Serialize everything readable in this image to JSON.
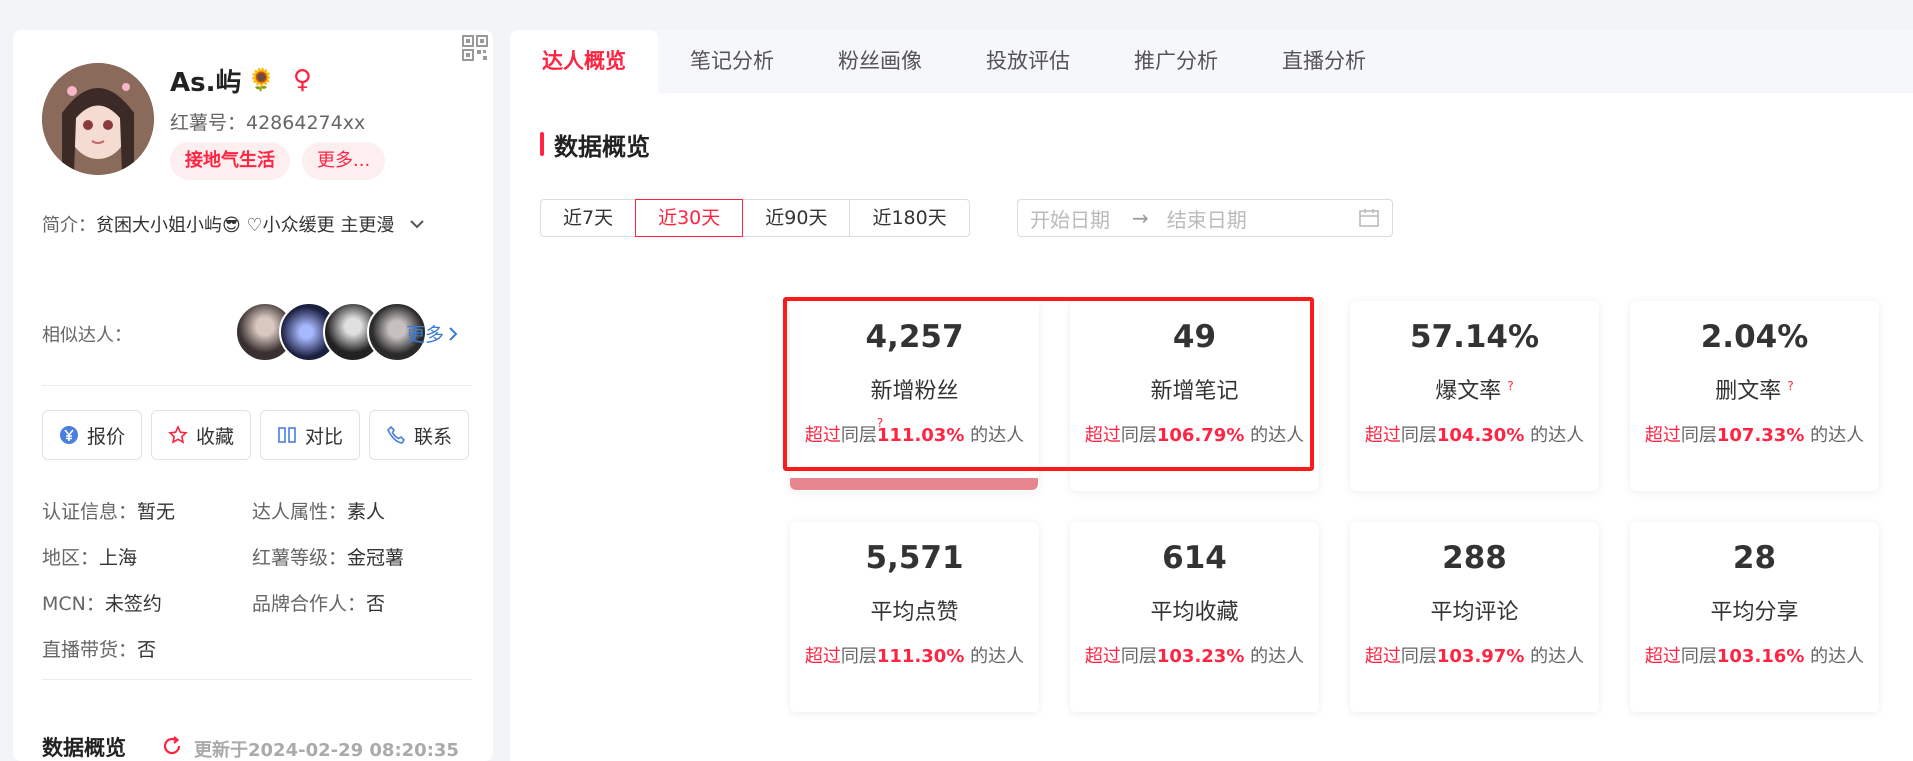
{
  "profile": {
    "name": "As.屿",
    "name_emoji": "🌻",
    "gender_symbol": "♀",
    "redid": "红薯号：42864274xx",
    "tags": [
      "接地气生活",
      "更多..."
    ],
    "intro_label": "简介：",
    "intro_text": "贫困大小姐小屿😎 ♡小众缓更 主更漫",
    "similar_label": "相似达人：",
    "more_label": "更多",
    "actions": [
      "报价",
      "收藏",
      "对比",
      "联系"
    ],
    "info": {
      "cert_label": "认证信息：",
      "cert_value": "暂无",
      "attr_label": "达人属性：",
      "attr_value": "素人",
      "region_label": "地区：",
      "region_value": "上海",
      "level_label": "红薯等级：",
      "level_value": "金冠薯",
      "mcn_label": "MCN：",
      "mcn_value": "未签约",
      "brand_label": "品牌合作人：",
      "brand_value": "否",
      "live_label": "直播带货：",
      "live_value": "否"
    },
    "overview_title": "数据概览",
    "updated": "更新于2024-02-29 08:20:35"
  },
  "tabs": [
    "达人概览",
    "笔记分析",
    "粉丝画像",
    "投放评估",
    "推广分析",
    "直播分析"
  ],
  "section_title": "数据概览",
  "periods": [
    "近7天",
    "近30天",
    "近90天",
    "近180天"
  ],
  "date_start_placeholder": "开始日期",
  "date_arrow": "→",
  "date_end_placeholder": "结束日期",
  "compare": {
    "exceed": "超过",
    "peer": "同层",
    "suffix": " 的达人",
    "q": "?"
  },
  "cards": [
    {
      "value": "4,257",
      "label": "新增粉丝",
      "pct": "111.03%"
    },
    {
      "value": "49",
      "label": "新增笔记",
      "pct": "106.79%"
    },
    {
      "value": "57.14%",
      "label": "爆文率",
      "pct": "104.30%"
    },
    {
      "value": "2.04%",
      "label": "删文率",
      "pct": "107.33%"
    },
    {
      "value": "5,571",
      "label": "平均点赞",
      "pct": "111.30%"
    },
    {
      "value": "614",
      "label": "平均收藏",
      "pct": "103.23%"
    },
    {
      "value": "288",
      "label": "平均评论",
      "pct": "103.97%"
    },
    {
      "value": "28",
      "label": "平均分享",
      "pct": "103.16%"
    }
  ],
  "colors": {
    "accent": "#ff2442",
    "highlight": "#ff1a1a",
    "link": "#3a7bd5"
  }
}
